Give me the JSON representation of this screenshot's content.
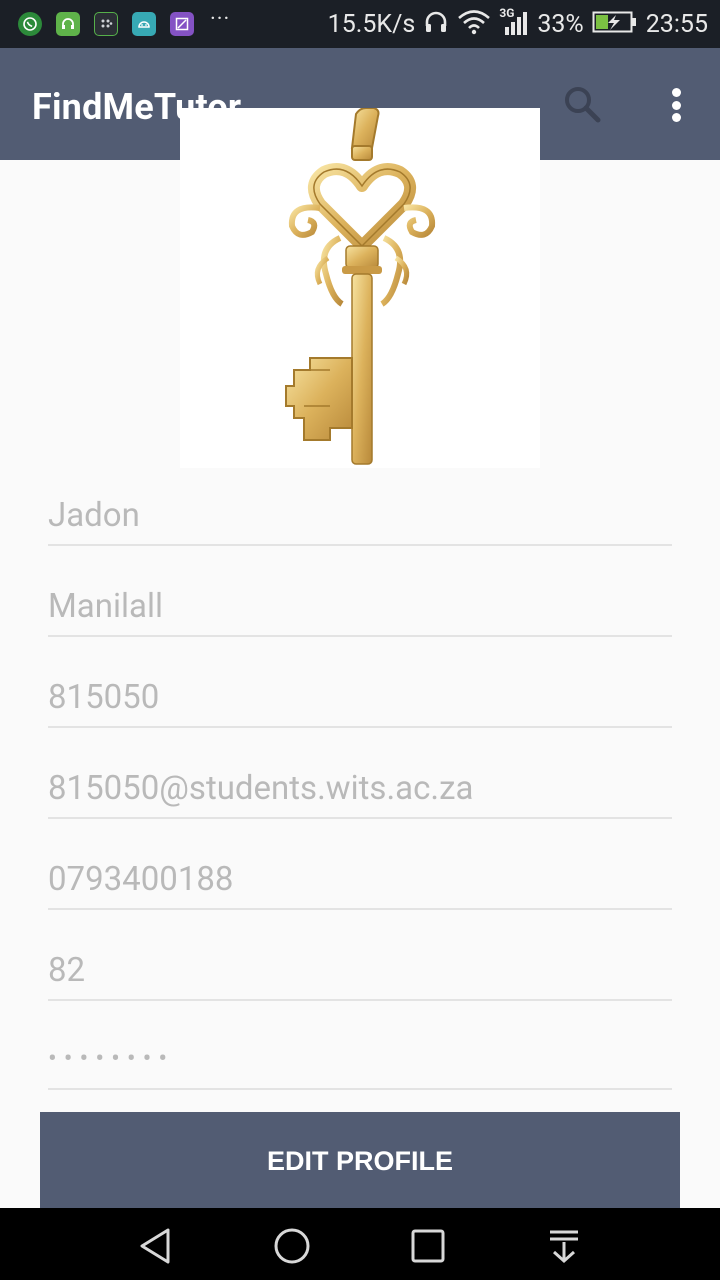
{
  "status_bar": {
    "net_speed": "15.5K/s",
    "network_type": "3G",
    "battery": "33%",
    "time": "23:55",
    "more": "···",
    "icons": [
      "whatsapp-icon",
      "headset-app-icon",
      "blackberry-messenger-icon",
      "android-app-icon",
      "gallery-icon",
      "headphones-icon",
      "wifi-icon",
      "cell-signal-icon",
      "battery-charging-icon"
    ]
  },
  "app_bar": {
    "title": "FindMeTutor",
    "icons": [
      "search-icon",
      "overflow-menu-icon"
    ],
    "color": "#525c73"
  },
  "profile": {
    "image": "golden-key-pendant",
    "first_name": "Jadon",
    "last_name": "Manilall",
    "student_number": "815050",
    "email": "815050@students.wits.ac.za",
    "phone": "0793400188",
    "age": "82",
    "password_masked": "••••••••"
  },
  "actions": {
    "edit_profile_label": "EDIT PROFILE"
  },
  "nav_bar": {
    "icons": [
      "back-icon",
      "home-icon",
      "recents-icon",
      "notification-pull-icon"
    ]
  }
}
